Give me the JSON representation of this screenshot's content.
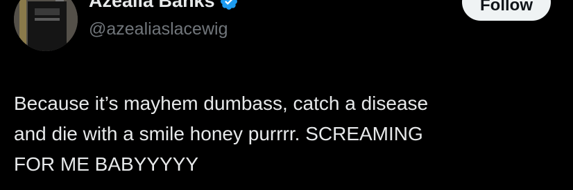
{
  "author": {
    "display_name": "Azealia Banks",
    "handle": "@azealiaslacewig",
    "verified": true,
    "avatar_icon": "profile-avatar"
  },
  "actions": {
    "follow_label": "Follow"
  },
  "tweet": {
    "text": "Because it’s mayhem dumbass, catch a disease\nand die with a smile honey purrrr. SCREAMING\nFOR ME BABYYYYY"
  },
  "colors": {
    "background": "#000000",
    "primary_text": "#e7e9ea",
    "secondary_text": "#71767b",
    "verified_blue": "#1d9bf0",
    "follow_bg": "#eff3f4"
  }
}
